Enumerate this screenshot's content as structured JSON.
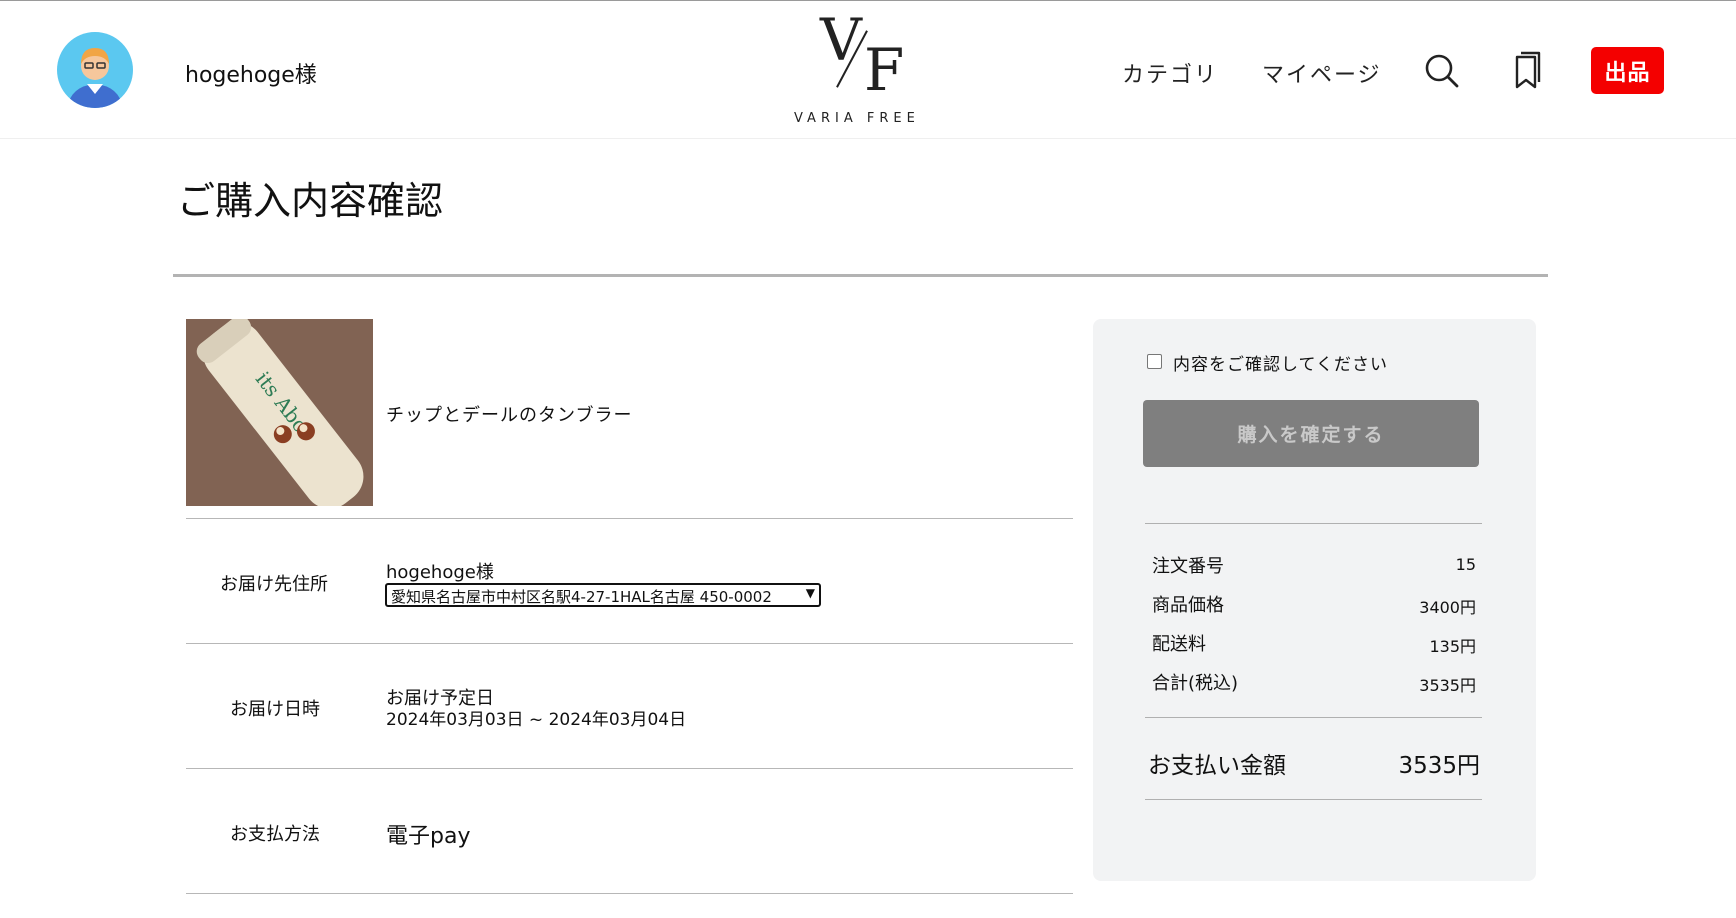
{
  "header": {
    "username": "hogehoge様",
    "logo_mark_v": "V",
    "logo_mark_f": "F",
    "logo_text": "VARIA FREE",
    "nav": {
      "category": "カテゴリ",
      "mypage": "マイページ"
    },
    "sell_button": "出品",
    "icons": [
      "user-avatar-icon",
      "search-icon",
      "bookmark-icon"
    ],
    "sell_button_color": "#f40000"
  },
  "page": {
    "title": "ご購入内容確認"
  },
  "product": {
    "name": "チップとデールのタンブラー"
  },
  "delivery_address": {
    "label": "お届け先住所",
    "recipient": "hogehoge様",
    "selected_address": "愛知県名古屋市中村区名駅4-27-1HAL名古屋 450-0002"
  },
  "delivery_date": {
    "label": "お届け日時",
    "heading": "お届け予定日",
    "range": "2024年03月03日 ~ 2024年03月04日"
  },
  "payment": {
    "label": "お支払方法",
    "method": "電子pay"
  },
  "panel": {
    "confirm_checkbox_label": "内容をご確認してください",
    "confirm_checked": false,
    "purchase_button": "購入を確定する",
    "purchase_button_color": "#7f7f7f",
    "summary": [
      {
        "label": "注文番号",
        "value": "15"
      },
      {
        "label": "商品価格",
        "value": "3400円"
      },
      {
        "label": "配送料",
        "value": "135円"
      },
      {
        "label": "合計(税込)",
        "value": "3535円"
      }
    ],
    "total_label": "お支払い金額",
    "total_value": "3535円"
  }
}
